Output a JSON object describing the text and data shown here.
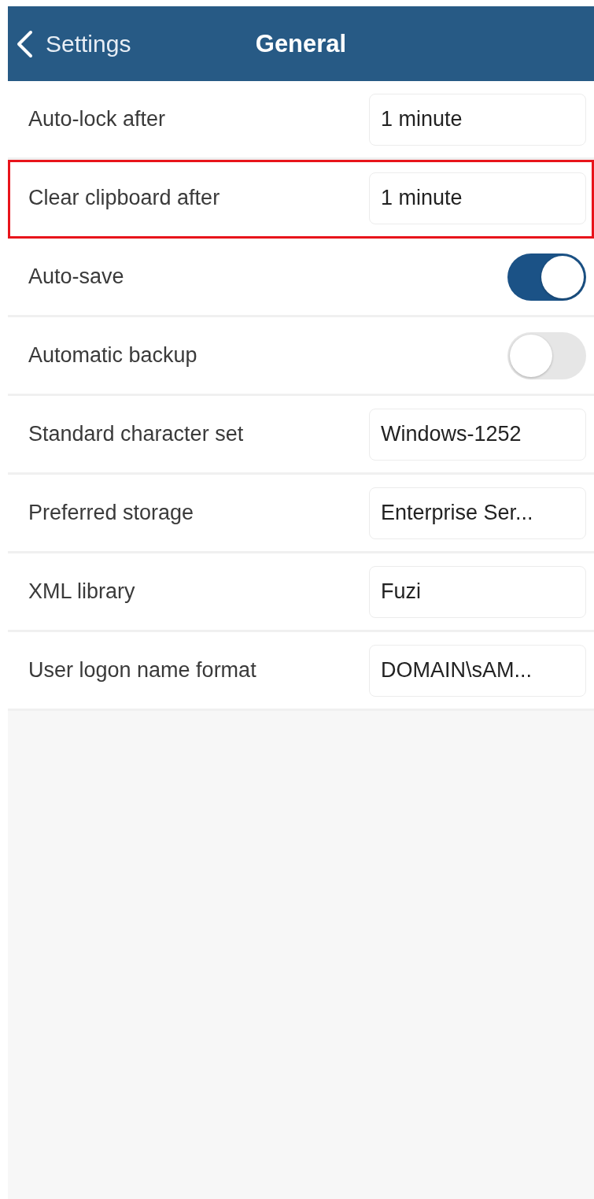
{
  "nav_bar": {
    "back_label": "Settings",
    "title": "General"
  },
  "settings": [
    {
      "kind": "select",
      "label": "Auto-lock after",
      "value": "1 minute",
      "highlighted": false
    },
    {
      "kind": "select",
      "label": "Clear clipboard after",
      "value": "1 minute",
      "highlighted": true
    },
    {
      "kind": "toggle",
      "label": "Auto-save",
      "on": true
    },
    {
      "kind": "toggle",
      "label": "Automatic backup",
      "on": false
    },
    {
      "kind": "select",
      "label": "Standard character set",
      "value": "Windows-1252",
      "highlighted": false
    },
    {
      "kind": "select",
      "label": "Preferred storage",
      "value": "Enterprise Ser...",
      "highlighted": false
    },
    {
      "kind": "select",
      "label": "XML library",
      "value": "Fuzi",
      "highlighted": false
    },
    {
      "kind": "select",
      "label": "User logon name format",
      "value": "DOMAIN\\sAM...",
      "highlighted": false
    }
  ]
}
